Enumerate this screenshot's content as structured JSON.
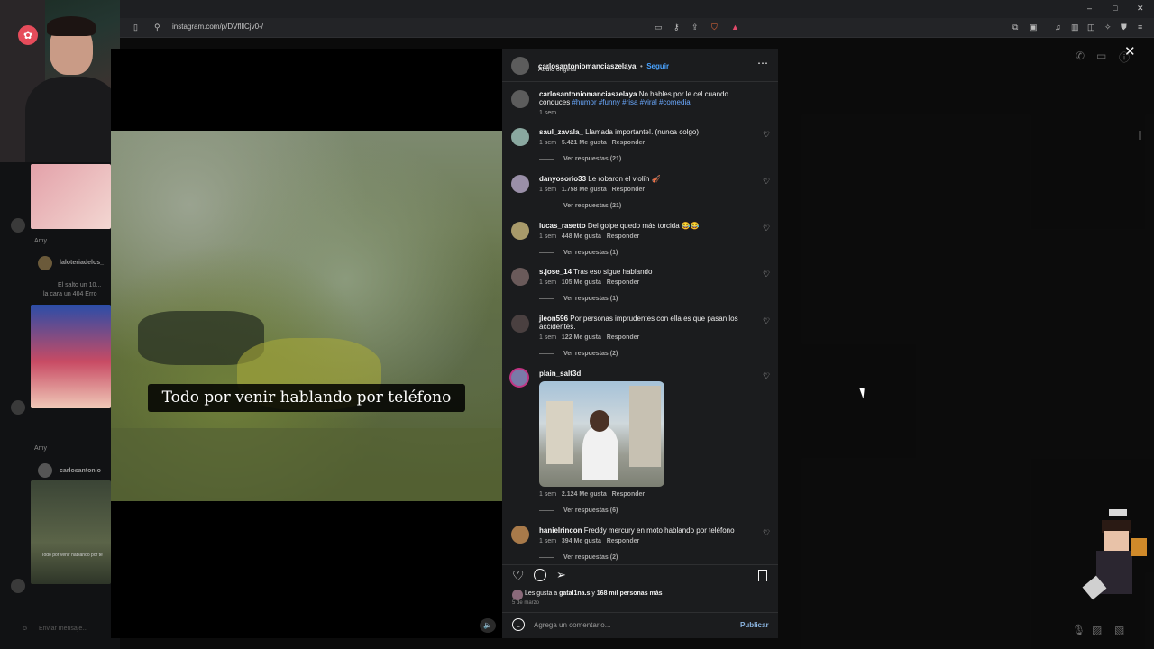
{
  "browser": {
    "url": "instagram.com/p/DVflllCjv0-/",
    "window_controls": [
      "–",
      "□",
      "✕"
    ]
  },
  "stream": {
    "chat_lines": [
      "Amy",
      "laloteriadelos_",
      "El salto un 10...",
      "la cara un 404 Erro",
      "Amy",
      "carlosantonio",
      "Todo por venir hablando por te"
    ],
    "chat_input_placeholder": "Enviar mensaje..."
  },
  "video": {
    "caption": "Todo por venir hablando por teléfono"
  },
  "post": {
    "author": "carlosantoniomanciaszelaya",
    "separator": "•",
    "follow_label": "Seguir",
    "audio": "Audio original",
    "more_icon": "⋯",
    "description_author": "carlosantoniomanciaszelaya",
    "description_text": "No hables por le cel cuando conduces",
    "hashtags": "#humor #funny #risa #viral #comedia",
    "description_time": "1 sem",
    "likes_text_pre": "Les gusta a ",
    "likes_user": "gatal1na.s",
    "likes_text_mid": " y ",
    "likes_count": "168 mil personas más",
    "date": "5 de marzo",
    "comment_placeholder": "Agrega un comentario...",
    "publish_label": "Publicar"
  },
  "comments": [
    {
      "user": "saul_zavala_",
      "text": "Llamada importante!. (nunca colgo)",
      "time": "1 sem",
      "likes": "5.421 Me gusta",
      "reply": "Responder",
      "replies": "Ver respuestas (21)"
    },
    {
      "user": "danyosorio33",
      "text": "Le robaron el violín 🎻",
      "time": "1 sem",
      "likes": "1.758 Me gusta",
      "reply": "Responder",
      "replies": "Ver respuestas (21)"
    },
    {
      "user": "lucas_rasetto",
      "text": "Del golpe quedo más torcida 😂😂",
      "time": "1 sem",
      "likes": "448 Me gusta",
      "reply": "Responder",
      "replies": "Ver respuestas (1)"
    },
    {
      "user": "s.jose_14",
      "text": "Tras eso sigue hablando",
      "time": "1 sem",
      "likes": "105 Me gusta",
      "reply": "Responder",
      "replies": "Ver respuestas (1)"
    },
    {
      "user": "jleon596",
      "text": "Por personas imprudentes con ella es que pasan los accidentes.",
      "time": "1 sem",
      "likes": "122 Me gusta",
      "reply": "Responder",
      "replies": "Ver respuestas (2)"
    },
    {
      "user": "plain_salt3d",
      "text": "",
      "time": "1 sem",
      "likes": "2.124 Me gusta",
      "reply": "Responder",
      "replies": "Ver respuestas (6)"
    },
    {
      "user": "hanielrincon",
      "text": "Freddy mercury en moto hablando por teléfono",
      "time": "1 sem",
      "likes": "394 Me gusta",
      "reply": "Responder",
      "replies": "Ver respuestas (2)"
    }
  ],
  "icons": {
    "heart": "heart-icon",
    "comment": "comment-icon",
    "share": "share-icon",
    "save": "bookmark-icon",
    "emoji": "emoji-icon",
    "close": "close-icon"
  },
  "colors": {
    "link_blue": "#6aa9ff",
    "panel_bg": "#1b1c1e"
  }
}
